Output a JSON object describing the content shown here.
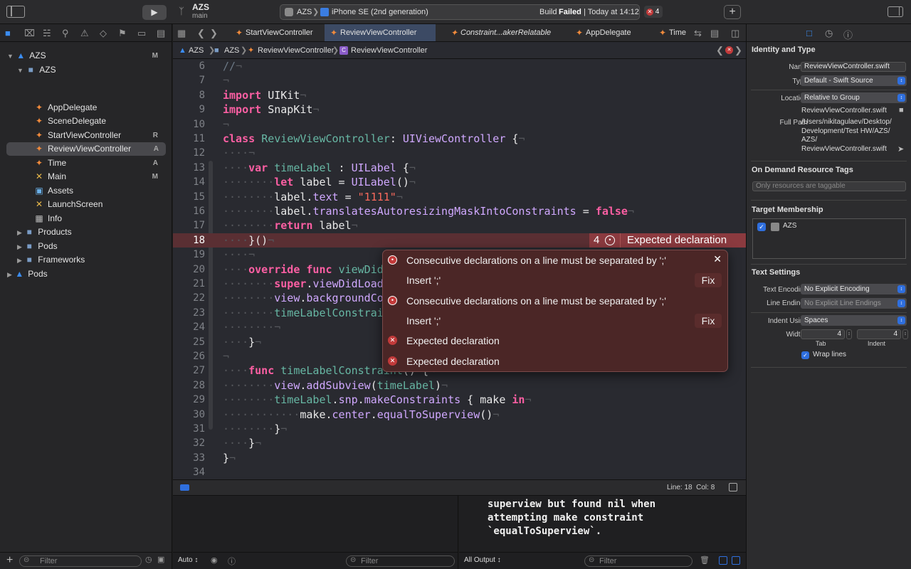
{
  "toolbar": {
    "project": "AZS",
    "branch": "main",
    "scheme": "AZS",
    "device": "iPhone SE (2nd generation)",
    "status_prefix": "Build",
    "status_result": "Failed",
    "status_time": "| Today at 14:12",
    "error_count": "4"
  },
  "tabs": [
    {
      "label": "StartViewController",
      "active": false
    },
    {
      "label": "ReviewViewController",
      "active": true
    },
    {
      "label": "Constraint...akerRelatable",
      "active": false
    },
    {
      "label": "AppDelegate",
      "active": false
    },
    {
      "label": "Time",
      "active": false
    }
  ],
  "breadcrumb": [
    "AZS",
    "AZS",
    "ReviewViewController",
    "ReviewViewController"
  ],
  "navigator": {
    "items": [
      {
        "label": "AZS",
        "flag": "M",
        "icon": "project-icon"
      },
      {
        "label": "AZS",
        "flag": "",
        "icon": "folder-icon"
      },
      {
        "label": "AppDelegate",
        "flag": "",
        "icon": "swift-file-icon"
      },
      {
        "label": "SceneDelegate",
        "flag": "",
        "icon": "swift-file-icon"
      },
      {
        "label": "StartViewController",
        "flag": "R",
        "icon": "swift-file-icon"
      },
      {
        "label": "ReviewViewController",
        "flag": "A",
        "icon": "swift-file-icon"
      },
      {
        "label": "Time",
        "flag": "A",
        "icon": "swift-file-icon"
      },
      {
        "label": "Main",
        "flag": "M",
        "icon": "storyboard-icon"
      },
      {
        "label": "Assets",
        "flag": "",
        "icon": "assets-icon"
      },
      {
        "label": "LaunchScreen",
        "flag": "",
        "icon": "storyboard-icon"
      },
      {
        "label": "Info",
        "flag": "",
        "icon": "plist-icon"
      },
      {
        "label": "Products",
        "flag": "",
        "icon": "folder-icon"
      },
      {
        "label": "Pods",
        "flag": "",
        "icon": "folder-icon"
      },
      {
        "label": "Frameworks",
        "flag": "",
        "icon": "folder-icon"
      },
      {
        "label": "Pods",
        "flag": "",
        "icon": "project-icon"
      }
    ],
    "filter_placeholder": "Filter"
  },
  "code": {
    "line_numbers": [
      "6",
      "7",
      "8",
      "9",
      "10",
      "11",
      "12",
      "13",
      "14",
      "15",
      "16",
      "17",
      "18",
      "19",
      "20",
      "21",
      "22",
      "23",
      "24",
      "25",
      "26",
      "27",
      "28",
      "29",
      "30",
      "31",
      "32",
      "33",
      "34"
    ],
    "inline_error_count": "4",
    "inline_error_text": "Expected declaration"
  },
  "issues": {
    "rows": [
      {
        "text": "Consecutive declarations on a line must be separated by ';'",
        "kind": "error"
      },
      {
        "text": "Insert ';'",
        "kind": "fix",
        "fix": "Fix"
      },
      {
        "text": "Consecutive declarations on a line must be separated by ';'",
        "kind": "error"
      },
      {
        "text": "Insert ';'",
        "kind": "fix",
        "fix": "Fix"
      },
      {
        "text": "Expected declaration",
        "kind": "error"
      },
      {
        "text": "Expected declaration",
        "kind": "error"
      }
    ]
  },
  "statusbar": {
    "position": "Line: 18  Col: 8"
  },
  "console": {
    "text": "superview but found nil when\nattempting make constraint\n`equalToSuperview`.",
    "scope": "Auto ↕",
    "output": "All Output ↕",
    "filter_placeholder": "Filter"
  },
  "inspector": {
    "identity_title": "Identity and Type",
    "name_label": "Name",
    "name_value": "ReviewViewController.swift",
    "type_label": "Type",
    "type_value": "Default - Swift Source",
    "location_label": "Location",
    "location_value": "Relative to Group",
    "location_file": "ReviewViewController.swift",
    "fullpath_label": "Full Path",
    "fullpath_value": "/Users/nikitagulaev/Desktop/\nDevelopment/Test HW/AZS/\nAZS/\nReviewViewController.swift",
    "odr_title": "On Demand Resource Tags",
    "odr_placeholder": "Only resources are taggable",
    "target_title": "Target Membership",
    "target_name": "AZS",
    "text_title": "Text Settings",
    "encoding_label": "Text Encoding",
    "encoding_value": "No Explicit Encoding",
    "endings_label": "Line Endings",
    "endings_value": "No Explicit Line Endings",
    "indent_label": "Indent Using",
    "indent_value": "Spaces",
    "widths_label": "Widths",
    "tab_value": "4",
    "indent_width_value": "4",
    "tab_caption": "Tab",
    "indent_caption": "Indent",
    "wrap_label": "Wrap lines"
  }
}
